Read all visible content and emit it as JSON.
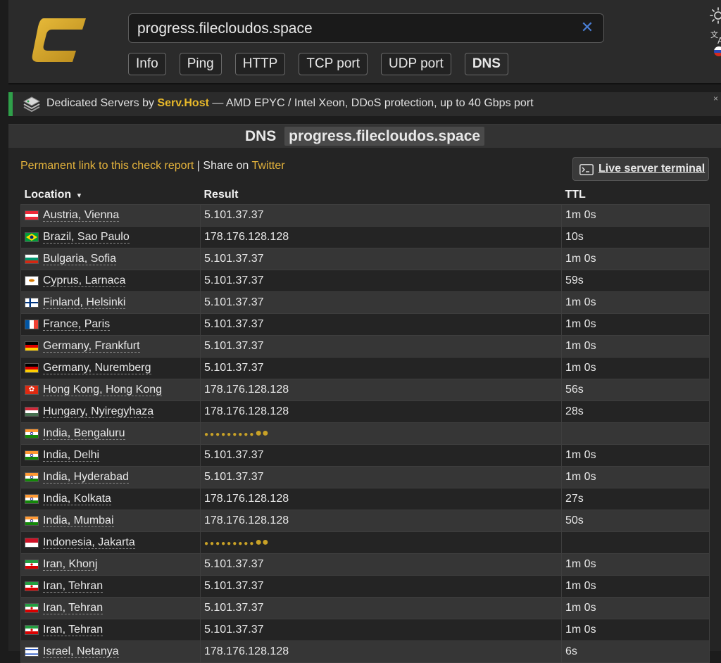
{
  "header": {
    "url_value": "progress.filecloudos.space",
    "tabs": [
      {
        "label": "Info"
      },
      {
        "label": "Ping"
      },
      {
        "label": "HTTP"
      },
      {
        "label": "TCP port"
      },
      {
        "label": "UDP port"
      },
      {
        "label": "DNS",
        "active": true
      }
    ]
  },
  "ad": {
    "prefix": "Dedicated Servers by ",
    "brand": "Serv.Host",
    "suffix": " — AMD EPYC / Intel Xeon, DDoS protection, up to 40 Gbps port",
    "close": "×"
  },
  "panel": {
    "title_prefix": "DNS",
    "title_host": "progress.filecloudos.space",
    "permanent_link": "Permanent link to this check report",
    "separator": " | Share on ",
    "twitter": "Twitter",
    "live_terminal": "Live server terminal"
  },
  "table": {
    "headers": {
      "location": "Location",
      "sort_indicator": "▾",
      "result": "Result",
      "ttl": "TTL"
    },
    "rows": [
      {
        "location": "Austria, Vienna",
        "flag": "austria",
        "result": "5.101.37.37",
        "ttl": "1m 0s"
      },
      {
        "location": "Brazil, Sao Paulo",
        "flag": "brazil",
        "result": "178.176.128.128",
        "ttl": "10s"
      },
      {
        "location": "Bulgaria, Sofia",
        "flag": "bulgaria",
        "result": "5.101.37.37",
        "ttl": "1m 0s"
      },
      {
        "location": "Cyprus, Larnaca",
        "flag": "cyprus",
        "result": "5.101.37.37",
        "ttl": "59s"
      },
      {
        "location": "Finland, Helsinki",
        "flag": "finland",
        "result": "5.101.37.37",
        "ttl": "1m 0s"
      },
      {
        "location": "France, Paris",
        "flag": "france",
        "result": "5.101.37.37",
        "ttl": "1m 0s"
      },
      {
        "location": "Germany, Frankfurt",
        "flag": "germany",
        "result": "5.101.37.37",
        "ttl": "1m 0s"
      },
      {
        "location": "Germany, Nuremberg",
        "flag": "germany",
        "result": "5.101.37.37",
        "ttl": "1m 0s"
      },
      {
        "location": "Hong Kong, Hong Kong",
        "flag": "hongkong",
        "result": "178.176.128.128",
        "ttl": "56s"
      },
      {
        "location": "Hungary, Nyiregyhaza",
        "flag": "hungary",
        "result": "178.176.128.128",
        "ttl": "28s"
      },
      {
        "location": "India, Bengaluru",
        "flag": "india",
        "result": "",
        "ttl": "",
        "loading": true
      },
      {
        "location": "India, Delhi",
        "flag": "india",
        "result": "5.101.37.37",
        "ttl": "1m 0s"
      },
      {
        "location": "India, Hyderabad",
        "flag": "india",
        "result": "5.101.37.37",
        "ttl": "1m 0s"
      },
      {
        "location": "India, Kolkata",
        "flag": "india",
        "result": "178.176.128.128",
        "ttl": "27s"
      },
      {
        "location": "India, Mumbai",
        "flag": "india",
        "result": "178.176.128.128",
        "ttl": "50s"
      },
      {
        "location": "Indonesia, Jakarta",
        "flag": "indonesia",
        "result": "",
        "ttl": "",
        "loading": true
      },
      {
        "location": "Iran, Khonj",
        "flag": "iran",
        "result": "5.101.37.37",
        "ttl": "1m 0s"
      },
      {
        "location": "Iran, Tehran",
        "flag": "iran",
        "result": "5.101.37.37",
        "ttl": "1m 0s"
      },
      {
        "location": "Iran, Tehran",
        "flag": "iran",
        "result": "5.101.37.37",
        "ttl": "1m 0s"
      },
      {
        "location": "Iran, Tehran",
        "flag": "iran",
        "result": "5.101.37.37",
        "ttl": "1m 0s"
      },
      {
        "location": "Israel, Netanya",
        "flag": "israel",
        "result": "178.176.128.128",
        "ttl": "6s"
      }
    ]
  },
  "icons": {
    "logo": "brand-logo",
    "clear": "close-x-icon",
    "theme": "sun-icon",
    "translate": "translate-icon",
    "language": "russia-flag-icon",
    "ad": "server-stack-icon",
    "terminal": "terminal-icon"
  },
  "colors": {
    "accent_gold": "#e3b23c",
    "logo_gold": "#d4a62a",
    "clear_blue": "#4a7fd6",
    "ad_green": "#2fa04a"
  }
}
